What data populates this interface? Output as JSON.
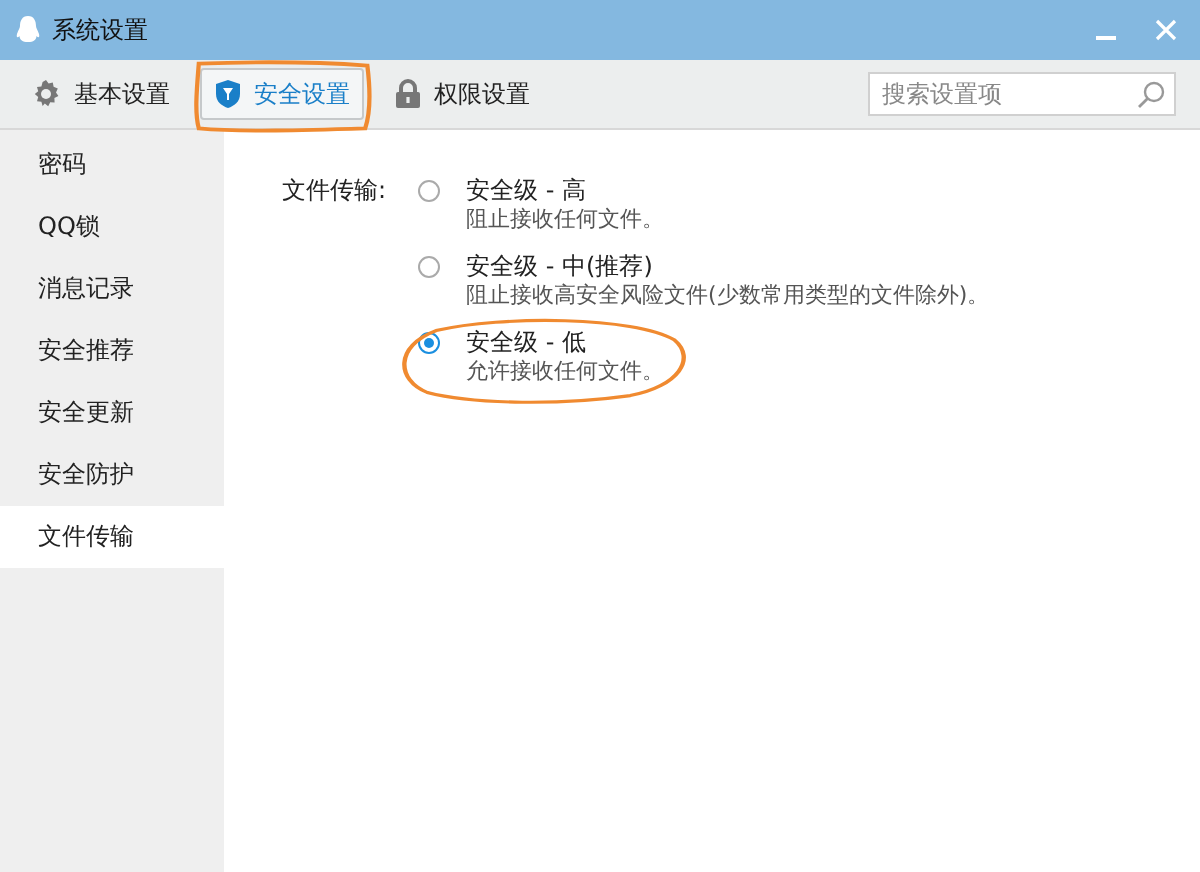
{
  "window": {
    "title": "系统设置"
  },
  "tabs": [
    {
      "label": "基本设置",
      "selected": false
    },
    {
      "label": "安全设置",
      "selected": true
    },
    {
      "label": "权限设置",
      "selected": false
    }
  ],
  "search": {
    "placeholder": "搜索设置项"
  },
  "sidebar": {
    "items": [
      {
        "label": "密码",
        "selected": false
      },
      {
        "label": "QQ锁",
        "selected": false
      },
      {
        "label": "消息记录",
        "selected": false
      },
      {
        "label": "安全推荐",
        "selected": false
      },
      {
        "label": "安全更新",
        "selected": false
      },
      {
        "label": "安全防护",
        "selected": false
      },
      {
        "label": "文件传输",
        "selected": true
      }
    ]
  },
  "file_transfer": {
    "label": "文件传输:",
    "options": [
      {
        "title": "安全级 - 高",
        "description": "阻止接收任何文件。",
        "selected": false
      },
      {
        "title": "安全级 - 中(推荐)",
        "description": "阻止接收高安全风险文件(少数常用类型的文件除外)。",
        "selected": false
      },
      {
        "title": "安全级 - 低",
        "description": "允许接收任何文件。",
        "selected": true
      }
    ]
  }
}
